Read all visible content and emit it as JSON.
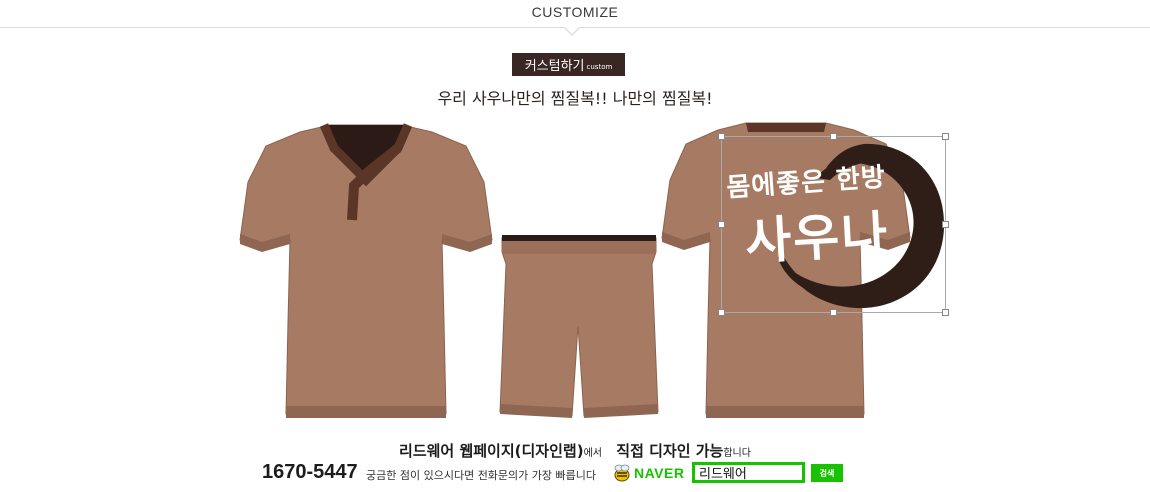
{
  "header": {
    "title": "CUSTOMIZE"
  },
  "badge": {
    "label": "커스텀하기",
    "sub": "custom"
  },
  "subtitle": "우리 사우나만의 찜질복!! 나만의 찜질복!",
  "print": {
    "line1": "몸에좋은 한방",
    "line2": "사우나"
  },
  "colors": {
    "garment": "#a77a63",
    "trim": "#5b3627",
    "badge": "#3a2723",
    "naver_green": "#19c200"
  },
  "footer": {
    "line1_a": "리드웨어 웹페이지(디자인랩)",
    "line1_b": "에서",
    "line1_c": "직접 디자인 가능",
    "line1_d": "합니다",
    "phone": "1670-5447",
    "phone_desc": "궁금한 점이 있으시다면 전화문의가 가장 빠릅니다",
    "naver_label": "NAVER",
    "search_value": "리드웨어",
    "search_button": "검색"
  }
}
